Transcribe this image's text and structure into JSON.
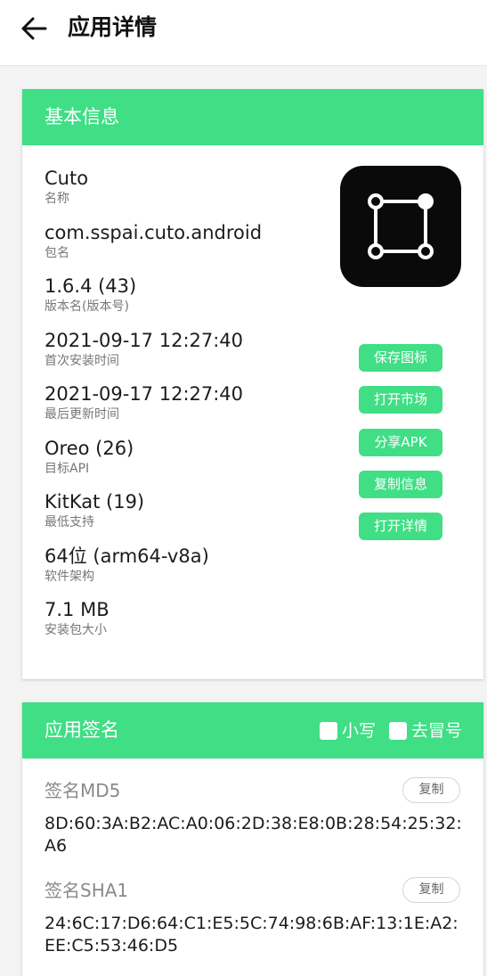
{
  "appbar": {
    "title": "应用详情"
  },
  "basic": {
    "title": "基本信息",
    "items": [
      {
        "value": "Cuto",
        "label": "名称"
      },
      {
        "value": "com.sspai.cuto.android",
        "label": "包名"
      },
      {
        "value": "1.6.4 (43)",
        "label": "版本名(版本号)"
      },
      {
        "value": "2021-09-17 12:27:40",
        "label": "首次安装时间"
      },
      {
        "value": "2021-09-17 12:27:40",
        "label": "最后更新时间"
      },
      {
        "value": "Oreo (26)",
        "label": "目标API"
      },
      {
        "value": "KitKat (19)",
        "label": "最低支持"
      },
      {
        "value": "64位 (arm64-v8a)",
        "label": "软件架构"
      },
      {
        "value": "7.1 MB",
        "label": "安装包大小"
      }
    ],
    "buttons": {
      "save_icon": "保存图标",
      "open_market": "打开市场",
      "share_apk": "分享APK",
      "copy_info": "复制信息",
      "open_details": "打开详情"
    }
  },
  "signature": {
    "title": "应用签名",
    "lowercase_label": "小写",
    "remove_colon_label": "去冒号",
    "md5": {
      "title": "签名MD5",
      "copy": "复制",
      "value": "8D:60:3A:B2:AC:A0:06:2D:38:E8:0B:28:54:25:32:A6"
    },
    "sha1": {
      "title": "签名SHA1",
      "copy": "复制",
      "value": "24:6C:17:D6:64:C1:E5:5C:74:98:6B:AF:13:1E:A2:EE:C5:53:46:D5"
    }
  },
  "colors": {
    "accent": "#40de85",
    "background": "#f3f3f3"
  },
  "icons": {
    "back": "arrow-left-icon",
    "app": "crop-frame-icon"
  }
}
